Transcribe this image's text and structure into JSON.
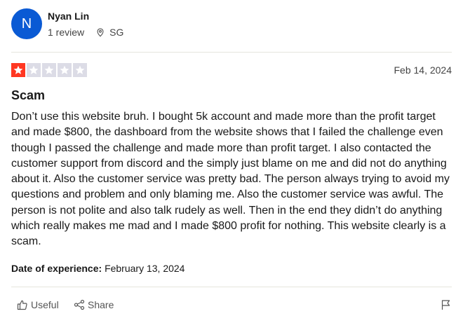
{
  "reviewer": {
    "initial": "N",
    "name": "Nyan Lin",
    "review_count": "1 review",
    "location": "SG",
    "avatar_color": "#0a5ad4"
  },
  "review": {
    "rating": 1,
    "rating_max": 5,
    "star_filled_color": "#ff3722",
    "star_empty_color": "#dcdce6",
    "date": "Feb 14, 2024",
    "title": "Scam",
    "body": "Don’t use this website bruh. I bought 5k account and made more than the profit target and made $800, the dashboard from the website shows that I failed the challenge even though I passed the challenge and made more than profit target. I also contacted the customer support from discord and the simply just blame on me and did not do anything about it. Also the customer service was pretty bad. The person always trying to avoid my questions and problem and only blaming me. Also the customer service was awful. The person is not polite and also talk rudely as well. Then in the end they didn’t do anything which really makes me mad and I made $800 profit for nothing. This website clearly is a scam.",
    "experience_label": "Date of experience:",
    "experience_date": "February 13, 2024"
  },
  "actions": {
    "useful_label": "Useful",
    "share_label": "Share"
  },
  "icons": {
    "location": "map-pin-icon",
    "useful": "thumbs-up-icon",
    "share": "share-icon",
    "report": "flag-icon",
    "star": "star-icon"
  }
}
